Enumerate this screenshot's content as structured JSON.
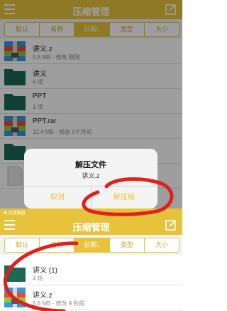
{
  "top_screen": {
    "title": "压缩管理",
    "sort_tabs": [
      "默认",
      "名称",
      "日期↓",
      "类型",
      "大小"
    ],
    "files": [
      {
        "name": "讲义.z",
        "meta": "5.6 MB - 修改 刚刚",
        "icon": "archive-icon"
      },
      {
        "name": "讲义",
        "meta": "4 项",
        "icon": "folder-icon"
      },
      {
        "name": "PPT",
        "meta": "1 项",
        "icon": "folder-icon"
      },
      {
        "name": "PPT.rar",
        "meta": "12.4 MB - 修改 5个月前",
        "icon": "archive-icon"
      },
      {
        "name": "",
        "meta": "",
        "icon": "folder-icon"
      },
      {
        "name": "",
        "meta": "",
        "icon": "document-icon"
      }
    ]
  },
  "dialog": {
    "title": "解压文件",
    "message": "讲义.z",
    "cancel_label": "取消",
    "extract_label": "解压缩"
  },
  "bottom_screen": {
    "back_app": "◀ 百度网盘",
    "title": "压缩管理",
    "sort_tabs": [
      "默认",
      "名称",
      "日期↓",
      "类型",
      "大小"
    ],
    "files": [
      {
        "name": "讲义 (1)",
        "meta": "4 项",
        "icon": "folder-icon"
      },
      {
        "name": "讲义.z",
        "meta": "5.6 MB - 修改 9 秒前",
        "icon": "archive-icon"
      }
    ]
  },
  "colors": {
    "accent": "#e7c33b",
    "folder": "#1b6a54",
    "scribble": "#e0201a"
  }
}
